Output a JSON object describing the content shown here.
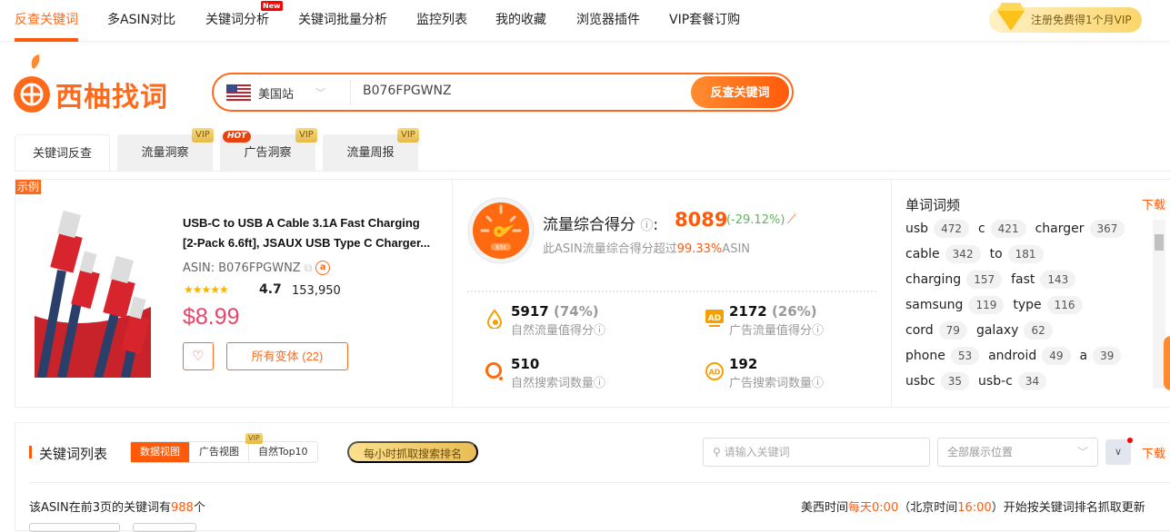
{
  "nav": {
    "items": [
      {
        "label": "反查关键词",
        "active": true
      },
      {
        "label": "多ASIN对比"
      },
      {
        "label": "关键词分析",
        "badge": "New"
      },
      {
        "label": "关键词批量分析"
      },
      {
        "label": "监控列表"
      },
      {
        "label": "我的收藏"
      },
      {
        "label": "浏览器插件"
      },
      {
        "label": "VIP套餐订购"
      }
    ],
    "promo": "注册免费得1个月VIP"
  },
  "logo": {
    "text": "西柚找词"
  },
  "search": {
    "site": "美国站",
    "value": "B076FPGWNZ",
    "button": "反查关键词"
  },
  "tabs": [
    {
      "label": "关键词反查",
      "active": true
    },
    {
      "label": "流量洞察",
      "badge": "VIP"
    },
    {
      "label": "广告洞察",
      "badge": "VIP",
      "hot": "HOT"
    },
    {
      "label": "流量周报",
      "badge": "VIP"
    }
  ],
  "product": {
    "example_tag": "示例",
    "title_line1": "USB-C to USB A Cable 3.1A Fast Charging",
    "title_line2": "[2-Pack 6.6ft], JSAUX USB Type C Charger...",
    "asin_label": "ASIN:",
    "asin": "B076FPGWNZ",
    "rating": "4.7",
    "rating_value": 4.7,
    "reviews": "153,950",
    "price": "$8.99",
    "variants": "所有变体 (22)"
  },
  "score": {
    "label": "流量综合得分",
    "value": "8089",
    "change": "(-29.12%)",
    "sub_prefix": "此ASIN流量综合得分超过",
    "sub_pct": "99.33%",
    "sub_suffix": "ASIN",
    "gauge_text": "834",
    "metrics": [
      {
        "value": "5917",
        "pct": "(74%)",
        "label": "自然流量值得分"
      },
      {
        "value": "2172",
        "pct": "(26%)",
        "label": "广告流量值得分"
      },
      {
        "value": "510",
        "label": "自然搜索词数量"
      },
      {
        "value": "192",
        "label": "广告搜索词数量"
      }
    ]
  },
  "word_freq": {
    "title": "单词词频",
    "download": "下载",
    "rows": [
      [
        [
          "usb",
          "472"
        ],
        [
          "c",
          "421"
        ],
        [
          "charger",
          "367"
        ]
      ],
      [
        [
          "cable",
          "342"
        ],
        [
          "to",
          "181"
        ]
      ],
      [
        [
          "charging",
          "157"
        ],
        [
          "fast",
          "143"
        ]
      ],
      [
        [
          "samsung",
          "119"
        ],
        [
          "type",
          "116"
        ]
      ],
      [
        [
          "cord",
          "79"
        ],
        [
          "galaxy",
          "62"
        ]
      ],
      [
        [
          "phone",
          "53"
        ],
        [
          "android",
          "49"
        ],
        [
          "a",
          "39"
        ]
      ],
      [
        [
          "usbc",
          "35"
        ],
        [
          "usb-c",
          "34"
        ]
      ]
    ]
  },
  "keywords": {
    "title": "关键词列表",
    "views": [
      "数据视图",
      "广告视图",
      "自然Top10"
    ],
    "view_vip": "VIP",
    "hourly": "每小时抓取搜索排名",
    "search_placeholder": "请输入关键词",
    "position": "全部展示位置",
    "download": "下载",
    "count_prefix": "该ASIN在前3页的关键词有",
    "count": "988",
    "count_suffix": "个",
    "sched": [
      "美西时间",
      "每天0:00",
      "（北京时间",
      "16:00",
      "）开始按关键词排名抓取更新"
    ]
  },
  "colors": {
    "accent": "#ff5a0a",
    "price": "#e8456a",
    "change": "#5cb85c"
  }
}
